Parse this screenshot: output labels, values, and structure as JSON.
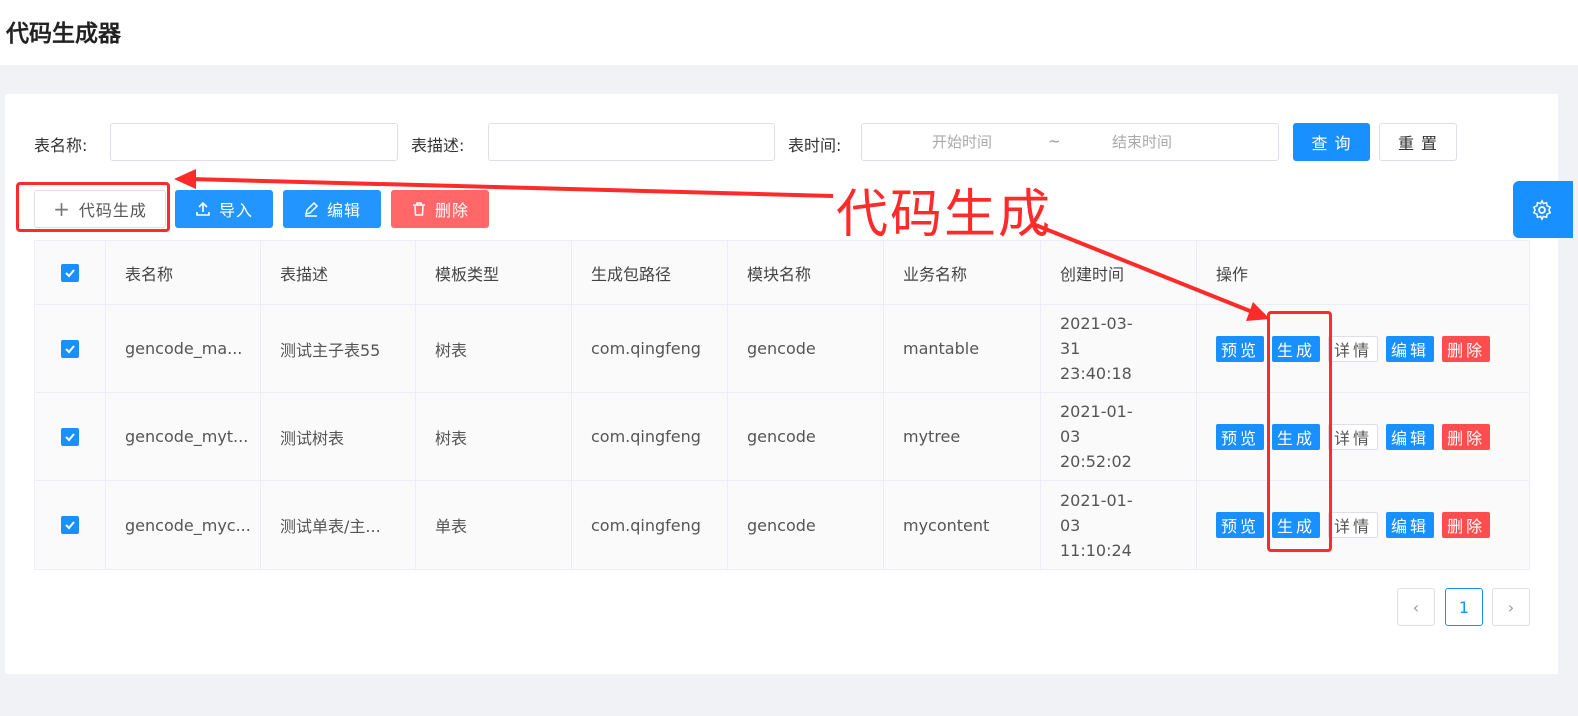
{
  "header": {
    "title": "代码生成器"
  },
  "search": {
    "table_name_label": "表名称:",
    "table_desc_label": "表描述:",
    "table_time_label": "表时间:",
    "start_placeholder": "开始时间",
    "range_separator": "~",
    "end_placeholder": "结束时间",
    "query_label": "查 询",
    "reset_label": "重 置"
  },
  "toolbar": {
    "gen_label": "代码生成",
    "import_label": "导入",
    "edit_label": "编辑",
    "delete_label": "删除"
  },
  "table": {
    "columns": [
      "表名称",
      "表描述",
      "模板类型",
      "生成包路径",
      "模块名称",
      "业务名称",
      "创建时间",
      "操作"
    ],
    "rows": [
      {
        "name": "gencode_ma...",
        "desc": "测试主子表55",
        "tpl": "树表",
        "pkg": "com.qingfeng",
        "module": "gencode",
        "biz": "mantable",
        "date": "2021-03-31",
        "time": "23:40:18"
      },
      {
        "name": "gencode_myt...",
        "desc": "测试树表",
        "tpl": "树表",
        "pkg": "com.qingfeng",
        "module": "gencode",
        "biz": "mytree",
        "date": "2021-01-03",
        "time": "20:52:02"
      },
      {
        "name": "gencode_myc...",
        "desc": "测试单表/主...",
        "tpl": "单表",
        "pkg": "com.qingfeng",
        "module": "gencode",
        "biz": "mycontent",
        "date": "2021-01-03",
        "time": "11:10:24"
      }
    ],
    "ops": {
      "preview": "预览",
      "generate": "生成",
      "detail": "详情",
      "edit": "编辑",
      "delete": "删除"
    }
  },
  "pagination": {
    "current": "1"
  },
  "annotation": {
    "text": "代码生成",
    "color": "#ff2a2a"
  },
  "colors": {
    "primary": "#1890ff",
    "danger": "#ff4d4f"
  }
}
